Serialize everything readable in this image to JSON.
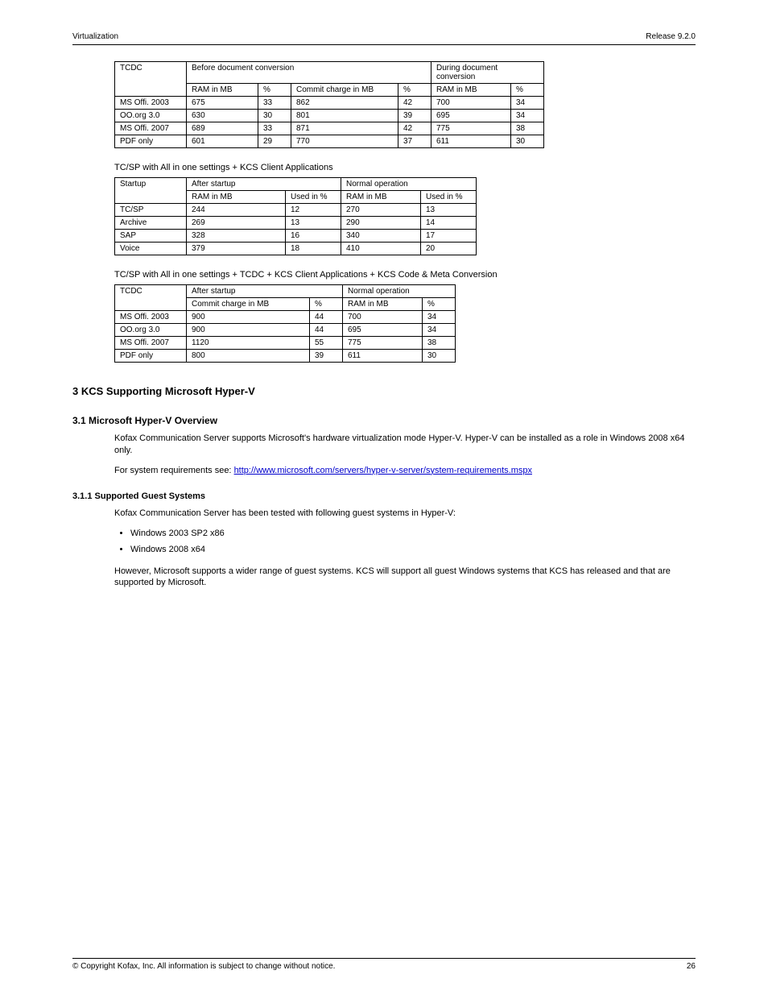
{
  "header": {
    "left": "Virtualization",
    "right": "Release 9.2.0"
  },
  "table1": {
    "caption": "TC/SP with All in one settings + TCDC + KCS Client Applications + KCS Code & Meta Conversion",
    "headers": {
      "c1": "TCDC",
      "c2": "Before document conversion",
      "c3": "During document conversion"
    },
    "sub1": {
      "c2a": "RAM in MB",
      "c2b": "%",
      "c2c": "Commit charge in MB",
      "c2d": "%",
      "c3a": "RAM in MB",
      "c3b": "%"
    },
    "rows": [
      {
        "c1": "MS Offi. 2003",
        "c2a": "675",
        "c2b": "33",
        "c2c": "862",
        "c2d": "42",
        "c3a": "700",
        "c3b": "34"
      },
      {
        "c1": "OO.org 3.0",
        "c2a": "630",
        "c2b": "30",
        "c2c": "801",
        "c2d": "39",
        "c3a": "695",
        "c3b": "34"
      },
      {
        "c1": "MS Offi. 2007",
        "c2a": "689",
        "c2b": "33",
        "c2c": "871",
        "c2d": "42",
        "c3a": "775",
        "c3b": "38"
      },
      {
        "c1": "PDF only",
        "c2a": "601",
        "c2b": "29",
        "c2c": "770",
        "c2d": "37",
        "c3a": "611",
        "c3b": "30"
      }
    ]
  },
  "table2": {
    "caption": "TC/SP with All in one settings + KCS Client Applications",
    "headers": {
      "c1": "Startup",
      "c2": "After startup",
      "c3": "Normal operation"
    },
    "sub1": {
      "c2a": "RAM in MB",
      "c2b": "Used in %",
      "c3a": "RAM in MB",
      "c3b": "Used in %"
    },
    "rows": [
      {
        "c1": "TC/SP",
        "c2a": "244",
        "c2b": "12",
        "c3a": "270",
        "c3b": "13"
      },
      {
        "c1": "Archive",
        "c2a": "269",
        "c2b": "13",
        "c3a": "290",
        "c3b": "14"
      },
      {
        "c1": "SAP",
        "c2a": "328",
        "c2b": "16",
        "c3a": "340",
        "c3b": "17"
      },
      {
        "c1": "Voice",
        "c2a": "379",
        "c2b": "18",
        "c3a": "410",
        "c3b": "20"
      }
    ]
  },
  "table3": {
    "caption": "TC/SP with All in one settings + TCDC + KCS Client Applications + KCS Code & Meta Conversion",
    "headers": {
      "c1": "TCDC",
      "c2": "After startup",
      "c3": "Normal operation"
    },
    "sub1": {
      "c2a": "Commit charge in MB",
      "c2b": "%",
      "c3a": "RAM in MB",
      "c3b": "%"
    },
    "rows": [
      {
        "c1": "MS Offi. 2003",
        "c2a": "900",
        "c2b": "44",
        "c3a": "700",
        "c3b": "34"
      },
      {
        "c1": "OO.org 3.0",
        "c2a": "900",
        "c2b": "44",
        "c3a": "695",
        "c3b": "34"
      },
      {
        "c1": "MS Offi. 2007",
        "c2a": "1120",
        "c2b": "55",
        "c3a": "775",
        "c3b": "38"
      },
      {
        "c1": "PDF only",
        "c2a": "800",
        "c2b": "39",
        "c3a": "611",
        "c3b": "30"
      }
    ]
  },
  "sections": {
    "s3": "3  KCS Supporting Microsoft Hyper-V",
    "s31": "3.1  Microsoft Hyper-V Overview",
    "p1": "Kofax Communication Server supports Microsoft's hardware virtualization mode Hyper-V. Hyper-V can be installed as a role in Windows 2008 x64 only.",
    "p2_pre": "For system requirements see: ",
    "p2_link": "http://www.microsoft.com/servers/hyper-v-server/system-requirements.mspx",
    "s311": "3.1.1  Supported Guest Systems",
    "p3": "Kofax Communication Server has been tested with following guest systems in Hyper-V:",
    "b1": "Windows 2003 SP2 x86",
    "b2": "Windows 2008 x64",
    "p4": "However, Microsoft supports a wider range of guest systems. KCS will support all guest Windows systems that KCS has released and that are supported by Microsoft."
  },
  "footer": {
    "left": "© Copyright Kofax, Inc. All information is subject to change without notice.",
    "right": "26"
  }
}
